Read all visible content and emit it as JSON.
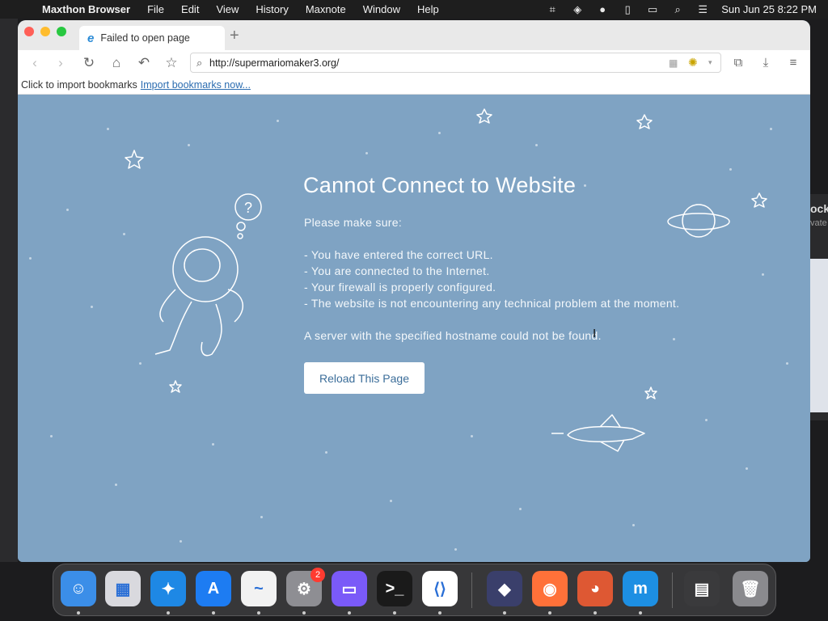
{
  "menubar": {
    "app_name": "Maxthon Browser",
    "items": [
      "File",
      "Edit",
      "View",
      "History",
      "Maxnote",
      "Window",
      "Help"
    ],
    "clock": "Sun Jun 25  8:22 PM"
  },
  "background_window": {
    "title_fragment": "ock",
    "subtitle_fragment": "vate"
  },
  "browser": {
    "tab_title": "Failed to open page",
    "url": "http://supermariomaker3.org/",
    "bookmark_bar": {
      "prompt": "Click to import bookmarks",
      "link": "Import bookmarks now..."
    }
  },
  "error_page": {
    "title": "Cannot Connect to Website",
    "intro": "Please make sure:",
    "checks": [
      "- You have entered the correct URL.",
      "- You are connected to the Internet.",
      "- Your firewall is properly configured.",
      "- The website is not encountering any technical problem at the moment."
    ],
    "detail": "A server with the specified hostname could not be found.",
    "reload_label": "Reload This Page"
  },
  "dock": {
    "apps": [
      {
        "name": "finder",
        "color": "#3b8ee8",
        "glyph": "☺"
      },
      {
        "name": "launchpad",
        "color": "#d9d9de",
        "glyph": "▦"
      },
      {
        "name": "safari",
        "color": "#1e88e5",
        "glyph": "✦"
      },
      {
        "name": "app-store",
        "color": "#1d7cf2",
        "glyph": "A"
      },
      {
        "name": "freeform",
        "color": "#f2f2f2",
        "glyph": "~"
      },
      {
        "name": "system-settings",
        "color": "#8e8e93",
        "glyph": "⚙"
      },
      {
        "name": "simulator",
        "color": "#7a5af8",
        "glyph": "▭"
      },
      {
        "name": "terminal",
        "color": "#1a1a1a",
        "glyph": ">_"
      },
      {
        "name": "vscode",
        "color": "#ffffff",
        "glyph": "⟨⟩"
      },
      {
        "name": "shortcuts",
        "color": "#3a3f6b",
        "glyph": "◆"
      },
      {
        "name": "firefox",
        "color": "#ff7139",
        "glyph": "◉"
      },
      {
        "name": "duckduckgo",
        "color": "#de5833",
        "glyph": "◕"
      },
      {
        "name": "maxthon",
        "color": "#1d8fe3",
        "glyph": "m"
      },
      {
        "name": "downloads-stack",
        "color": "#3a3a3c",
        "glyph": "▤"
      },
      {
        "name": "trash",
        "color": "#8a8a8e",
        "glyph": "🗑"
      }
    ],
    "settings_badge": "2"
  }
}
